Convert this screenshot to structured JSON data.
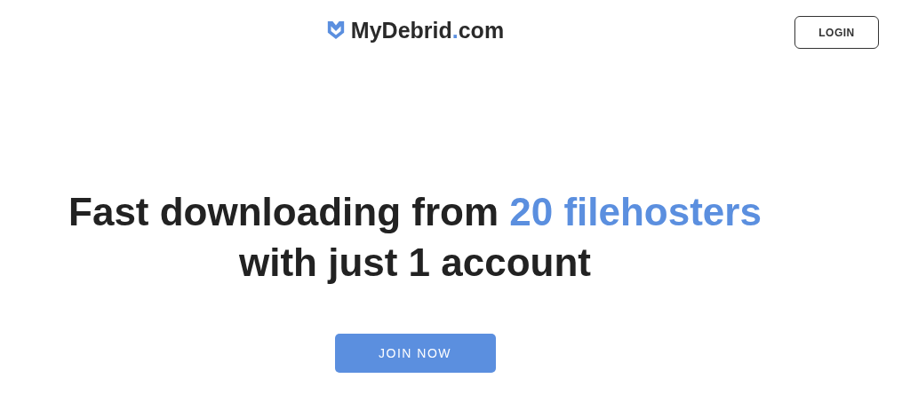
{
  "header": {
    "logo": {
      "name": "MyDebrid",
      "dot": ".",
      "suffix": "com"
    },
    "login_button": "LOGIN"
  },
  "hero": {
    "headline_start": "Fast downloading from ",
    "headline_highlight": "20 filehosters",
    "headline_end": "with just 1 account",
    "cta_button": "JOIN NOW"
  }
}
